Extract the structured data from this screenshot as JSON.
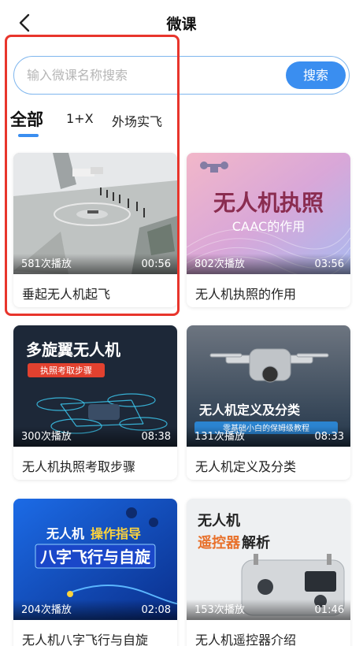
{
  "header": {
    "title": "微课"
  },
  "search": {
    "placeholder": "输入微课名称搜索",
    "button_label": "搜索"
  },
  "tabs": [
    {
      "label": "全部",
      "active": true
    },
    {
      "label": "1+X",
      "active": false
    },
    {
      "label": "外场实飞",
      "active": false
    }
  ],
  "colors": {
    "accent": "#3a8ef0",
    "highlight": "#e8352c"
  },
  "courses": [
    {
      "title": "垂起无人机起飞",
      "plays": "581次播放",
      "duration": "00:56"
    },
    {
      "title": "无人机执照的作用",
      "plays": "802次播放",
      "duration": "03:56",
      "thumb_title": "无人机执照",
      "thumb_subtitle": "CAAC的作用"
    },
    {
      "title": "无人机执照考取步骤",
      "plays": "300次播放",
      "duration": "08:38",
      "thumb_title": "多旋翼无人机",
      "thumb_tag": "执照考取步骤"
    },
    {
      "title": "无人机定义及分类",
      "plays": "131次播放",
      "duration": "08:33",
      "thumb_title": "无人机定义及分类",
      "thumb_tag": "零基础小白的保姆级教程"
    },
    {
      "title": "无人机八字飞行与自旋",
      "plays": "204次播放",
      "duration": "02:08",
      "thumb_line1a": "无人机",
      "thumb_line1b": "操作指导",
      "thumb_line2": "八字飞行与自旋"
    },
    {
      "title": "无人机遥控器介绍",
      "plays": "153次播放",
      "duration": "01:46",
      "thumb_line1": "无人机",
      "thumb_line2a": "遥控器",
      "thumb_line2b": "解析"
    }
  ]
}
